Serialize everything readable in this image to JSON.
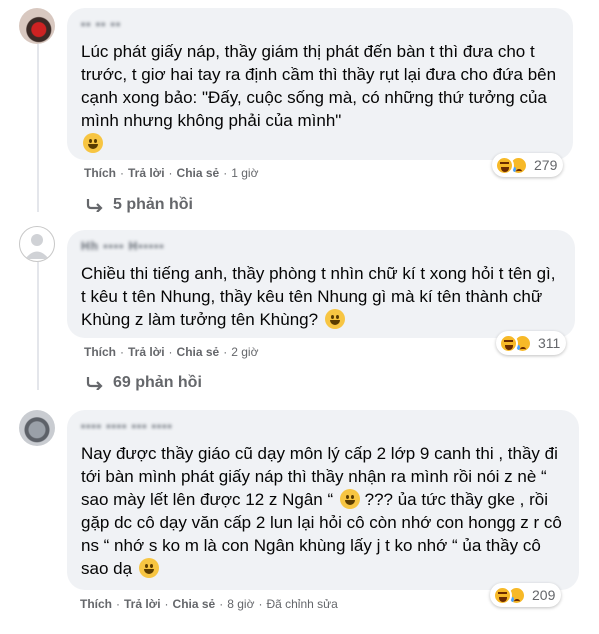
{
  "comments": [
    {
      "author": "▪▪ ▪▪ ▪▪",
      "text": "Lúc phát giấy náp, thầy giám thị phát đến bàn t thì đưa cho t trước, t giơ hai tay ra định cầm thì thầy rụt lại đưa cho đứa bên cạnh xong bảo: \"Đấy, cuộc sống mà, có những thứ tưởng của mình nhưng không phải của mình\"",
      "reactions": "279",
      "like": "Thích",
      "reply": "Trả lời",
      "share": "Chia sẻ",
      "time": "1 giờ",
      "replies": "5 phản hồi"
    },
    {
      "author": "Hh ▪▪▪▪ H▪▪▪▪▪",
      "text": "Chiều thi tiếng anh, thầy phòng t nhìn chữ kí t xong hỏi t tên gì, t kêu t tên Nhung, thầy kêu tên Nhung gì mà kí tên thành chữ Khùng z làm tưởng tên Khùng?",
      "reactions": "311",
      "like": "Thích",
      "reply": "Trả lời",
      "share": "Chia sẻ",
      "time": "2 giờ",
      "replies": "69 phản hồi"
    },
    {
      "author": "▪▪▪▪ ▪▪▪▪ ▪▪▪ ▪▪▪▪",
      "text_a": "Nay được thầy giáo cũ dạy môn lý cấp 2 lớp 9 canh thi , thầy đi tới bàn mình phát giấy náp thì thầy nhận ra mình rồi nói z nè “ sao mày lết lên được 12 z Ngân “",
      "text_b": "??? ủa tức thầy gke , rồi gặp dc cô dạy văn cấp 2 lun lại hỏi cô còn nhớ con hongg z r cô ns “ nhớ s ko m là con Ngân khùng lấy j t ko nhớ “ ủa thầy cô sao dạ",
      "reactions": "209",
      "like": "Thích",
      "reply": "Trả lời",
      "share": "Chia sẻ",
      "time": "8 giờ",
      "edited": "Đã chỉnh sửa"
    }
  ],
  "colors": {
    "bubble": "#f0f2f5",
    "meta": "#65676b",
    "text": "#050505"
  }
}
